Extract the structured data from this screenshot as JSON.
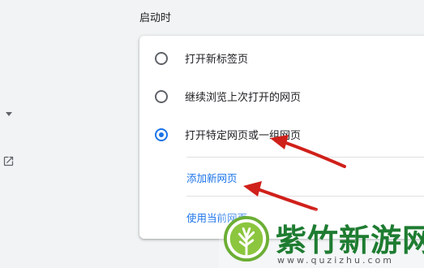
{
  "section": {
    "title": "启动时"
  },
  "options": [
    {
      "label": "打开新标签页",
      "checked": false
    },
    {
      "label": "继续浏览上次打开的网页",
      "checked": false
    },
    {
      "label": "打开特定网页或一组网页",
      "checked": true
    }
  ],
  "links": {
    "add_page": "添加新网页",
    "use_current": "使用当前网页"
  },
  "colors": {
    "accent": "#1a73e8",
    "annotation_arrow": "#d0201a",
    "watermark_green": "#1e7c31"
  },
  "watermark": {
    "brand": "紫竹新游网",
    "url": "www.quzizhu.com"
  }
}
